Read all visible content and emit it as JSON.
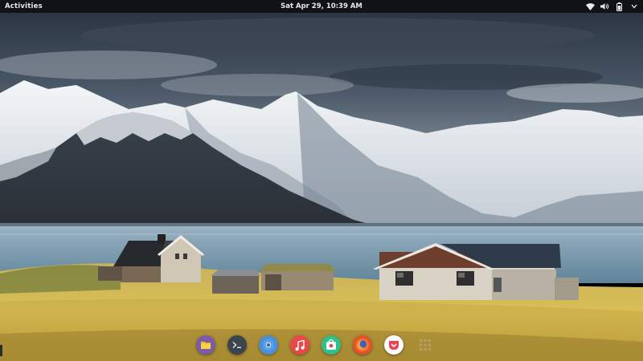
{
  "topbar": {
    "activities_label": "Activities",
    "clock": "Sat Apr 29, 10:39 AM",
    "tray_icons": [
      "wifi-icon",
      "volume-icon",
      "battery-icon",
      "power-menu-icon"
    ]
  },
  "wallpaper": {
    "scene": "mountains-lake-cottages"
  },
  "dock": {
    "apps": [
      {
        "name": "files-icon",
        "color": "#7d5ba6"
      },
      {
        "name": "terminal-icon",
        "color": "#3c4450"
      },
      {
        "name": "chromium-icon",
        "color": "#4b8fd6"
      },
      {
        "name": "music-icon",
        "color": "#e84a4a"
      },
      {
        "name": "software-center-icon",
        "color": "#2fbf8a"
      },
      {
        "name": "firefox-icon",
        "color": "#e5532a"
      },
      {
        "name": "pocket-icon",
        "color": "#ef4056"
      },
      {
        "name": "show-applications-icon",
        "color": "#b8b8b8"
      }
    ]
  }
}
